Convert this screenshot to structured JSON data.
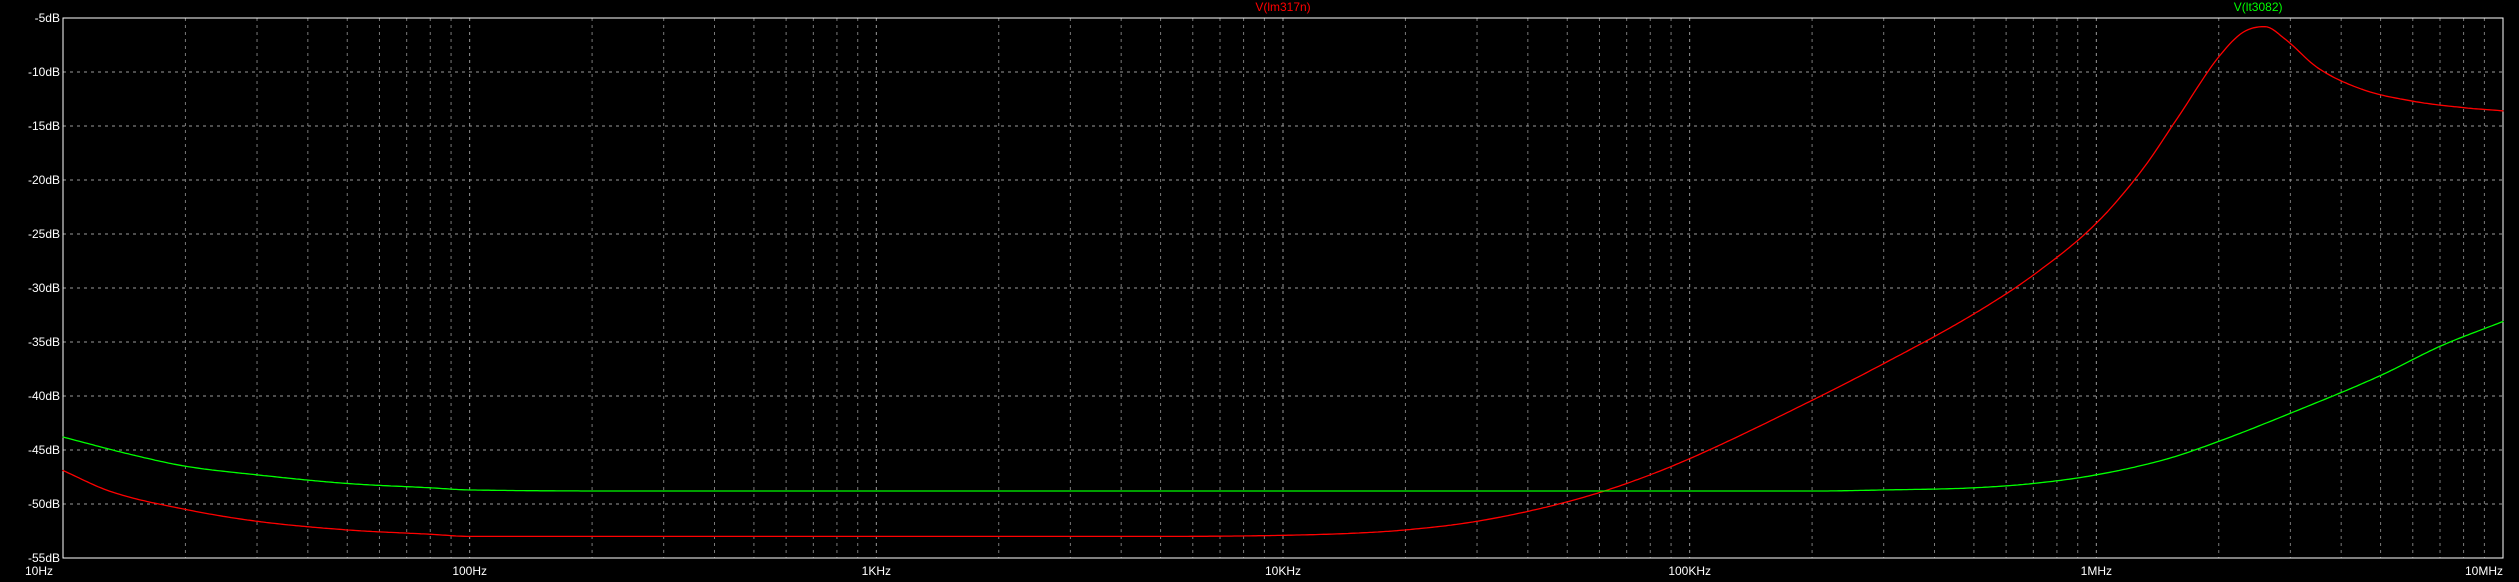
{
  "chart_data": {
    "type": "line",
    "x_scale": "log",
    "grid": true,
    "xlim": [
      10,
      10000000
    ],
    "ylim": [
      -55,
      -5
    ],
    "x_ticks": [
      {
        "value": 10,
        "label": "10Hz"
      },
      {
        "value": 100,
        "label": "100Hz"
      },
      {
        "value": 1000,
        "label": "1KHz"
      },
      {
        "value": 10000,
        "label": "10KHz"
      },
      {
        "value": 100000,
        "label": "100KHz"
      },
      {
        "value": 1000000,
        "label": "1MHz"
      },
      {
        "value": 10000000,
        "label": "10MHz"
      }
    ],
    "y_ticks": [
      {
        "value": -5,
        "label": "-5dB"
      },
      {
        "value": -10,
        "label": "-10dB"
      },
      {
        "value": -15,
        "label": "-15dB"
      },
      {
        "value": -20,
        "label": "-20dB"
      },
      {
        "value": -25,
        "label": "-25dB"
      },
      {
        "value": -30,
        "label": "-30dB"
      },
      {
        "value": -35,
        "label": "-35dB"
      },
      {
        "value": -40,
        "label": "-40dB"
      },
      {
        "value": -45,
        "label": "-45dB"
      },
      {
        "value": -50,
        "label": "-50dB"
      },
      {
        "value": -55,
        "label": "-55dB"
      }
    ],
    "series": [
      {
        "name": "V(lm317n)",
        "color": "#ff0000",
        "legend_freq": 10000,
        "points": [
          [
            10,
            -46.9
          ],
          [
            13,
            -48.8
          ],
          [
            20,
            -50.5
          ],
          [
            30,
            -51.6
          ],
          [
            50,
            -52.4
          ],
          [
            80,
            -52.8
          ],
          [
            100,
            -53.0
          ],
          [
            200,
            -53.0
          ],
          [
            1000,
            -53.0
          ],
          [
            5000,
            -53.0
          ],
          [
            10000,
            -52.9
          ],
          [
            15000,
            -52.7
          ],
          [
            20000,
            -52.4
          ],
          [
            30000,
            -51.6
          ],
          [
            50000,
            -49.8
          ],
          [
            70000,
            -48.1
          ],
          [
            100000,
            -45.8
          ],
          [
            200000,
            -40.4
          ],
          [
            300000,
            -37.0
          ],
          [
            500000,
            -32.4
          ],
          [
            700000,
            -28.8
          ],
          [
            1000000,
            -24.0
          ],
          [
            1300000,
            -19.0
          ],
          [
            1600000,
            -14.0
          ],
          [
            2000000,
            -8.6
          ],
          [
            2300000,
            -6.3
          ],
          [
            2600000,
            -5.8
          ],
          [
            2900000,
            -6.9
          ],
          [
            3500000,
            -9.6
          ],
          [
            4500000,
            -11.6
          ],
          [
            6000000,
            -12.7
          ],
          [
            8000000,
            -13.3
          ],
          [
            10000000,
            -13.6
          ]
        ]
      },
      {
        "name": "V(lt3082)",
        "color": "#00ff00",
        "legend_freq": 2500000,
        "points": [
          [
            10,
            -43.8
          ],
          [
            15,
            -45.5
          ],
          [
            20,
            -46.5
          ],
          [
            30,
            -47.3
          ],
          [
            50,
            -48.1
          ],
          [
            80,
            -48.5
          ],
          [
            100,
            -48.7
          ],
          [
            300,
            -48.8
          ],
          [
            1000,
            -48.8
          ],
          [
            10000,
            -48.8
          ],
          [
            100000,
            -48.8
          ],
          [
            200000,
            -48.8
          ],
          [
            300000,
            -48.7
          ],
          [
            500000,
            -48.5
          ],
          [
            700000,
            -48.1
          ],
          [
            1000000,
            -47.3
          ],
          [
            1500000,
            -45.8
          ],
          [
            2000000,
            -44.2
          ],
          [
            3000000,
            -41.6
          ],
          [
            5000000,
            -38.1
          ],
          [
            7000000,
            -35.4
          ],
          [
            10000000,
            -33.1
          ]
        ]
      }
    ]
  }
}
